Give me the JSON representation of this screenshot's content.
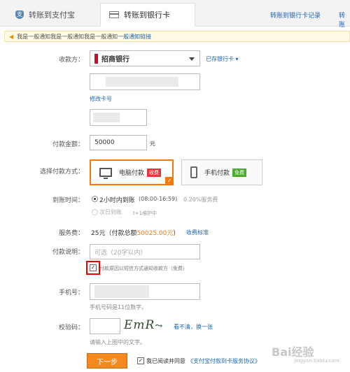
{
  "tabs": {
    "alipay": "转账到支付宝",
    "bank": "转账到银行卡",
    "records_link": "转账到银行卡记录",
    "more_link": "转账"
  },
  "notice": {
    "text": "我是一般通知我是一般通知我是一般通知",
    "link": "一般通知链接"
  },
  "form": {
    "payee_label": "收款方：",
    "bank_selected": "招商银行",
    "saved_cards_link": "已存银行卡",
    "edit_card_link": "修改卡号",
    "amount_label": "付款金额：",
    "amount_value": "50000",
    "amount_unit": "元",
    "method_label": "选择付款方式：",
    "method_pc": "电脑付款",
    "method_pc_tag": "收费",
    "method_mobile": "手机付款",
    "method_mobile_tag": "免费",
    "arrival_label": "到账时间：",
    "arrival_option1": "2小时内到账",
    "arrival_option1_time": "(08:00-16:59)",
    "arrival_option1_fee": "0.20%服务费",
    "arrival_option2": "次日到账",
    "arrival_option2_note": "t+1维护中",
    "fee_label": "服务费：",
    "fee_value": "25元",
    "fee_total_prefix": "（付款总额",
    "fee_total_amount": "50025.00元",
    "fee_total_suffix": "）",
    "fee_standard_link": "收费标准",
    "note_label": "付款说明：",
    "note_placeholder": "可选（20字以内）",
    "sms_notify_text": "付款原因以短信方式通知收款方（免费）",
    "phone_label": "手机号：",
    "phone_hint": "手机号码是11位数字。",
    "captcha_label": "校验码：",
    "captcha_image_text": "EmR",
    "captcha_refresh_link": "看不清，换一张",
    "captcha_hint": "请输入上图中的文字。",
    "next_button": "下一步",
    "agree_text": "我已阅读并同意",
    "agreement_link": "《支付宝付款到卡服务协议》"
  },
  "watermark": {
    "main": "Bai经验",
    "sub": "jingyan.baidu.com"
  },
  "colors": {
    "accent_orange": "#f5780b",
    "link_blue": "#1a64b7",
    "tag_red": "#e4393c",
    "tag_green": "#4caa2f",
    "highlight_red": "#e00000"
  }
}
